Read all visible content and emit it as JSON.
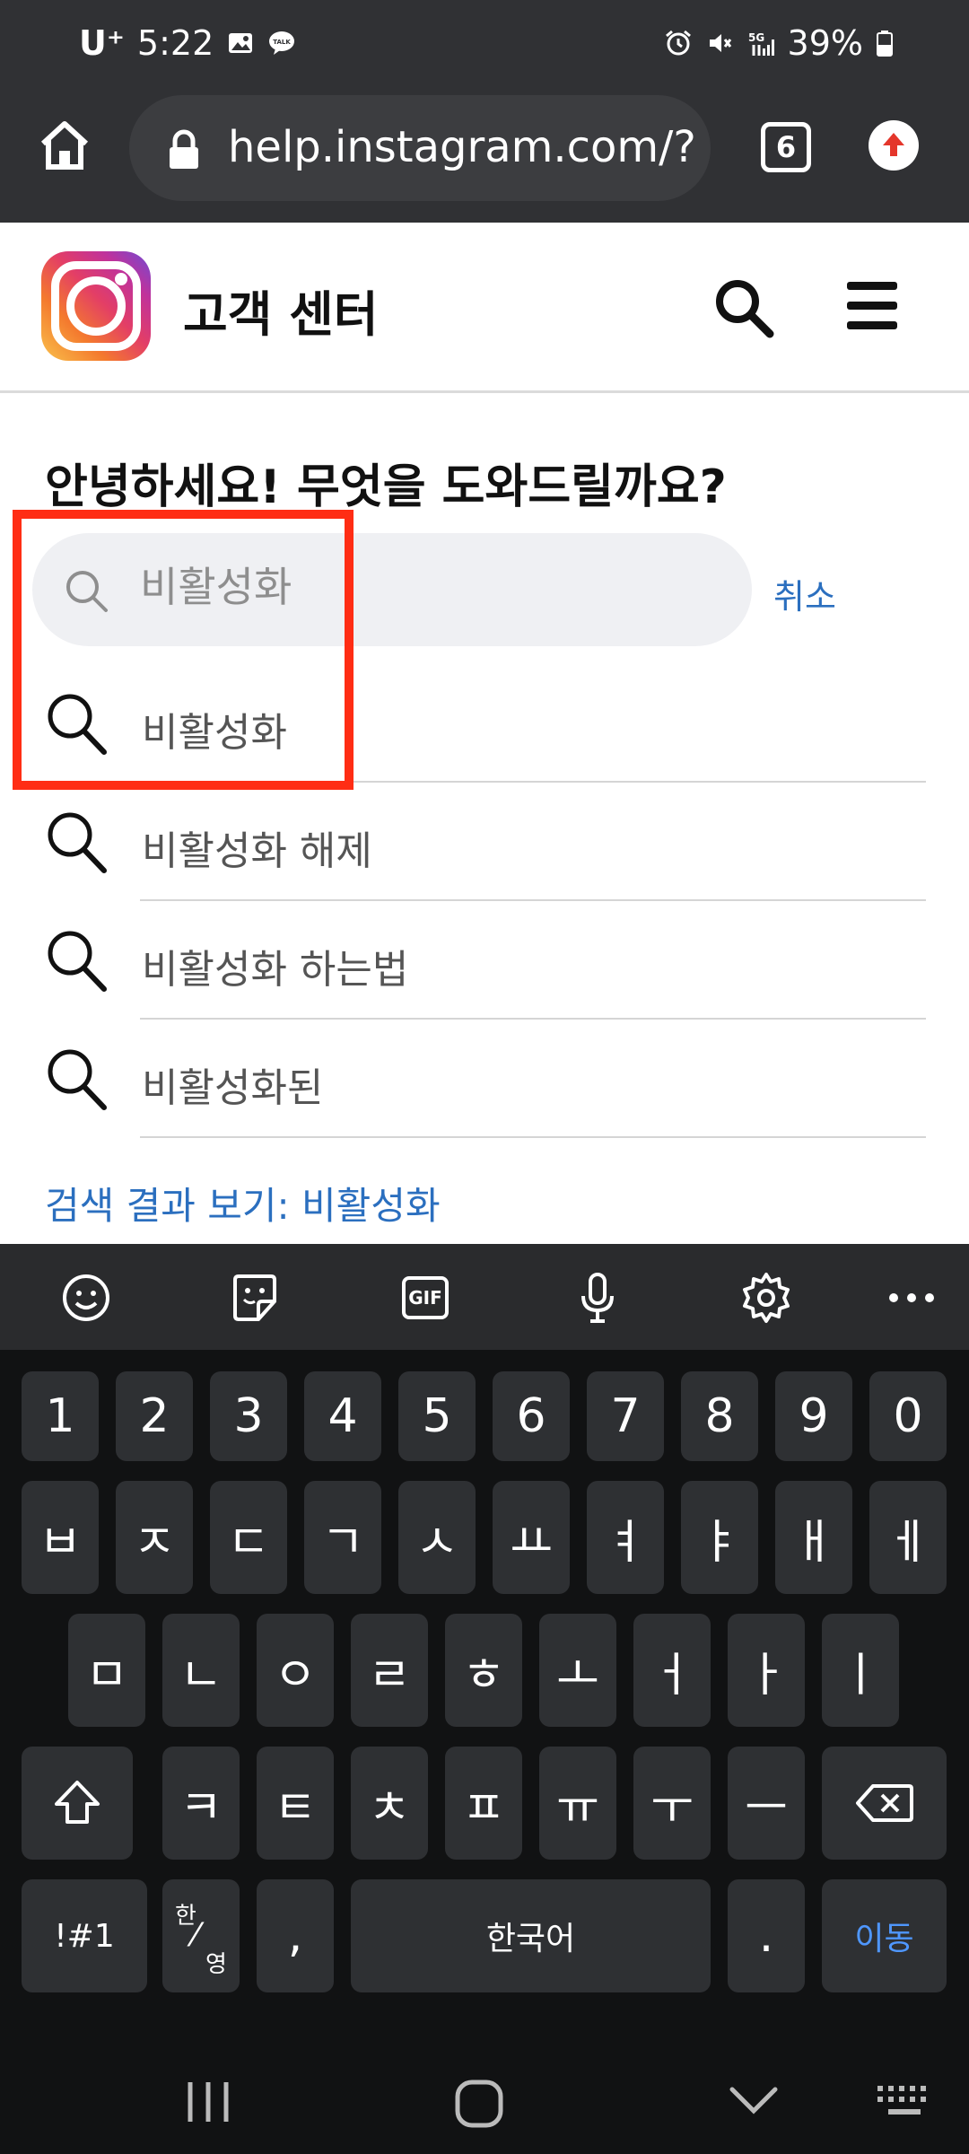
{
  "status_bar": {
    "carrier": "U⁺",
    "time": "5:22",
    "battery": "39%"
  },
  "browser": {
    "url": "help.instagram.com/?a",
    "tab_count": "6"
  },
  "header": {
    "title": "고객 센터"
  },
  "main": {
    "greeting": "안녕하세요! 무엇을 도와드릴까요?",
    "search_value": "비활성화",
    "cancel_label": "취소",
    "suggestions": [
      {
        "label": "비활성화"
      },
      {
        "label": "비활성화 해제"
      },
      {
        "label": "비활성화 하는법"
      },
      {
        "label": "비활성화된"
      }
    ],
    "see_results_label": "검색 결과 보기: 비활성화"
  },
  "keyboard": {
    "toolbar": [
      "emoji-icon",
      "sticker-icon",
      "gif-icon",
      "microphone-icon",
      "settings-icon",
      "more-icon"
    ],
    "gif_label": "GIF",
    "row_numbers": [
      "1",
      "2",
      "3",
      "4",
      "5",
      "6",
      "7",
      "8",
      "9",
      "0"
    ],
    "row1": [
      "ㅂ",
      "ㅈ",
      "ㄷ",
      "ㄱ",
      "ㅅ",
      "ㅛ",
      "ㅕ",
      "ㅑ",
      "ㅐ",
      "ㅔ"
    ],
    "row2": [
      "ㅁ",
      "ㄴ",
      "ㅇ",
      "ㄹ",
      "ㅎ",
      "ㅗ",
      "ㅓ",
      "ㅏ",
      "ㅣ"
    ],
    "row3": [
      "ㅋ",
      "ㅌ",
      "ㅊ",
      "ㅍ",
      "ㅠ",
      "ㅜ",
      "ㅡ"
    ],
    "symbols_label": "!#1",
    "lang_top": "한",
    "lang_bottom": "영",
    "comma_label": ",",
    "space_label": "한국어",
    "period_label": ".",
    "enter_label": "이동"
  },
  "colors": {
    "highlight": "#ff2d14",
    "link": "#2b6fbf",
    "keyboard_accent": "#4f97ff"
  }
}
